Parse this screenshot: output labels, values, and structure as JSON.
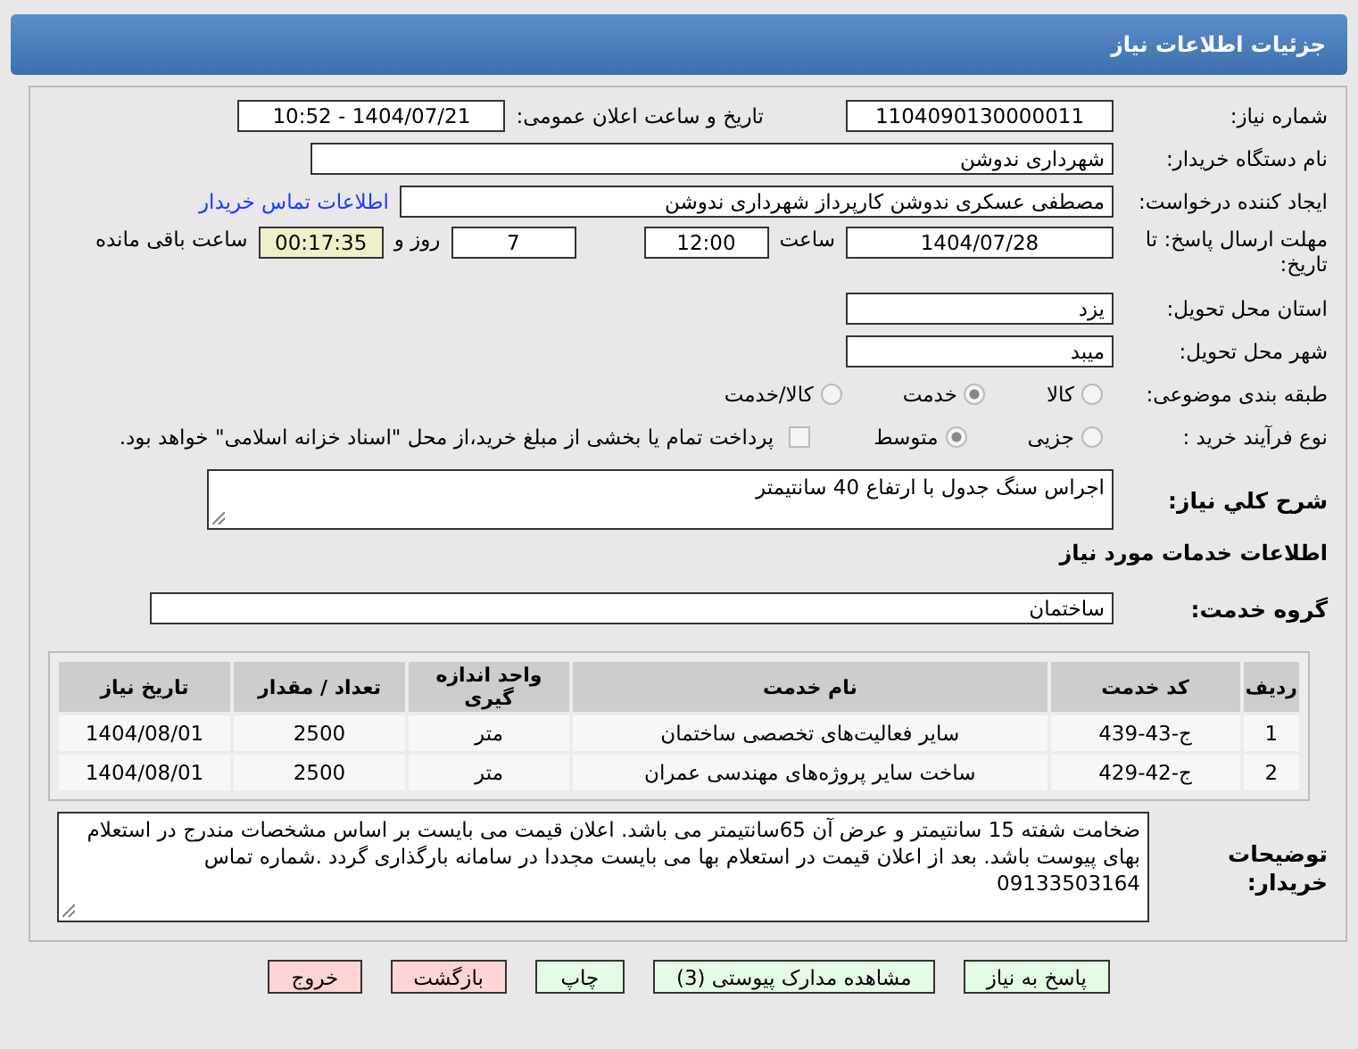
{
  "header": {
    "title": "جزئیات اطلاعات نیاز"
  },
  "fields": {
    "need_number": {
      "label": "شماره نیاز:",
      "value": "1104090130000011"
    },
    "announce": {
      "label": "تاریخ و ساعت اعلان عمومی:",
      "value": "1404/07/21 - 10:52"
    },
    "buyer_org": {
      "label": "نام دستگاه خریدار:",
      "value": "شهرداری ندوشن"
    },
    "requester": {
      "label": "ایجاد کننده درخواست:",
      "value": "مصطفی عسکری ندوشن کارپرداز شهرداری ندوشن"
    },
    "contact_link": "اطلاعات تماس خریدار",
    "deadline": {
      "label": "مهلت ارسال پاسخ: تا تاریخ:",
      "date": "1404/07/28",
      "time_label": "ساعت",
      "time": "12:00",
      "days": "7",
      "days_label": "روز و",
      "remaining": "00:17:35",
      "remaining_label": "ساعت باقی مانده"
    },
    "province": {
      "label": "استان محل تحویل:",
      "value": "یزد"
    },
    "city": {
      "label": "شهر محل تحویل:",
      "value": "میبد"
    }
  },
  "category": {
    "label": "طبقه بندی موضوعی:",
    "options": [
      {
        "label": "کالا",
        "selected": false
      },
      {
        "label": "خدمت",
        "selected": true
      },
      {
        "label": "کالا/خدمت",
        "selected": false
      }
    ]
  },
  "process": {
    "label": "نوع فرآیند خرید :",
    "options": [
      {
        "label": "جزیی",
        "selected": false
      },
      {
        "label": "متوسط",
        "selected": true
      }
    ],
    "payment": {
      "checked": false,
      "text": "پرداخت تمام یا بخشی از مبلغ خرید،از محل \"اسناد خزانه اسلامی\" خواهد بود."
    }
  },
  "summary": {
    "label": "شرح کلي نياز:",
    "value": "اجراس سنگ جدول با ارتفاع 40 سانتیمتر"
  },
  "services_title": "اطلاعات خدمات مورد نیاز",
  "service_group": {
    "label": "گروه خدمت:",
    "value": "ساختمان"
  },
  "table": {
    "columns": [
      "ردیف",
      "کد خدمت",
      "نام خدمت",
      "واحد اندازه گیری",
      "تعداد / مقدار",
      "تاریخ نیاز"
    ],
    "rows": [
      [
        "1",
        "ج-43-439",
        "سایر فعالیت‌های تخصصی ساختمان",
        "متر",
        "2500",
        "1404/08/01"
      ],
      [
        "2",
        "ج-42-429",
        "ساخت سایر پروژه‌های مهندسی عمران",
        "متر",
        "2500",
        "1404/08/01"
      ]
    ]
  },
  "notes": {
    "label": "توضیحات خریدار:",
    "value": "ضخامت شفته 15 سانتیمتر و عرض آن 65سانتیمتر می باشد. اعلان قیمت می بایست بر اساس مشخصات مندرج در استعلام بهای پیوست باشد. بعد از اعلان قیمت در استعلام بها می بایست مجددا در سامانه بارگذاری گردد .شماره تماس 09133503164"
  },
  "buttons": [
    {
      "label": "پاسخ به نیاز",
      "kind": "normal"
    },
    {
      "label": "مشاهده مدارک پیوستی (3)",
      "kind": "normal"
    },
    {
      "label": "چاپ",
      "kind": "normal"
    },
    {
      "label": "بازگشت",
      "kind": "danger"
    },
    {
      "label": "خروج",
      "kind": "danger"
    }
  ]
}
